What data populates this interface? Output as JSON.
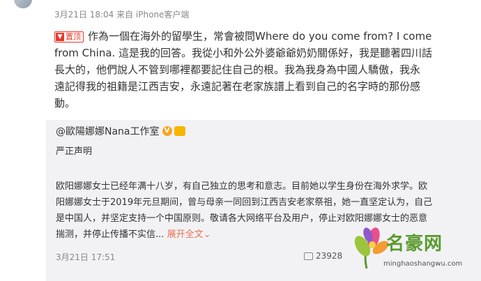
{
  "post": {
    "meta": "3月21日 18:04 来自 iPhone客户端",
    "pin_label": "置顶",
    "lines": [
      "作為一個在海外的留學生，常會被問Where do you come from? I come",
      "from China. 這是我的回答。我從小和外公外婆爺爺奶奶關係好，我是聽著四川話",
      "長大的，他們說人不管到哪裡都要記住自己的根。我為我身為中國人驕傲，我永",
      "遠記得我的祖籍是江西吉安，永遠記著在老家族譜上看到自己的名字時的那份感",
      "動。"
    ]
  },
  "repost": {
    "author": "@歐陽娜娜Nana工作室",
    "subtitle": "严正声明",
    "lines": [
      "欧阳娜娜女士已经年满十八岁，有自己独立的思考和意志。目前她以学生身份在海外求学。欧",
      "阳娜娜女士于2019年元旦期间，曾与母亲一同回到江西吉安老家祭祖，她一直坚定认为，自己",
      "是中国人，并坚定支持一个中国原则。敬请各大网络平台及用户，停止对欧阳娜娜女士的恶意",
      "揣测，并停止传播不实信"
    ],
    "ellipsis": "...",
    "expand_label": "展开全文",
    "expand_icon": "chevron-down",
    "date": "3月21日 17:51",
    "share_count": "23928"
  },
  "watermark": {
    "name": "名豪网",
    "url": "minghaoshangwu.com"
  },
  "colors": {
    "pin": "#e8372c",
    "link": "#eb7350",
    "repost_bg": "#f2f2f5",
    "watermark_green": "#5a9b2e"
  }
}
